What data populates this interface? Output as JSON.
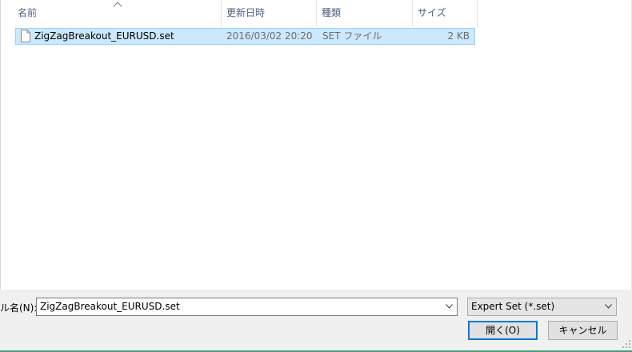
{
  "columns": {
    "name": "名前",
    "date": "更新日時",
    "type": "種類",
    "size": "サイズ"
  },
  "files": [
    {
      "name": "ZigZagBreakout_EURUSD.set",
      "date": "2016/03/02 20:20",
      "type": "SET ファイル",
      "size": "2 KB",
      "icon": "document-icon",
      "selected": true
    }
  ],
  "footer": {
    "filename_label": "ル名(N):",
    "filename_value": "ZigZagBreakout_EURUSD.set",
    "filter_value": "Expert Set (*.set)",
    "open_label": "開く(O)",
    "cancel_label": "キャンセル"
  },
  "colors": {
    "selection_bg": "#cce8ff",
    "selection_border": "#99d1ff",
    "header_text": "#4d6082",
    "primary_border": "#0078d7"
  }
}
